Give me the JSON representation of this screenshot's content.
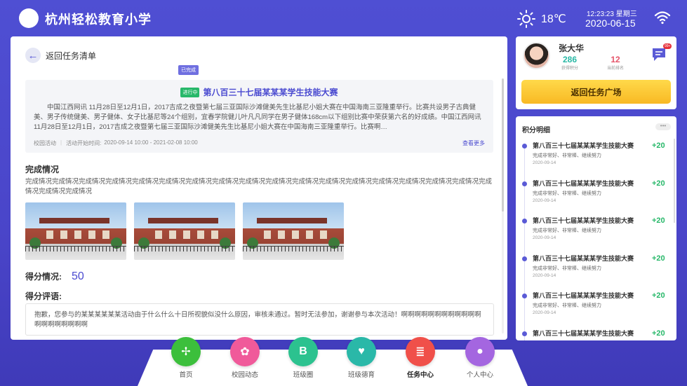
{
  "header": {
    "school": "杭州轻松教育小学",
    "temperature": "18℃",
    "time": "12:23:23 星期三",
    "date": "2020-06-15"
  },
  "task": {
    "back_label": "返回任务清单",
    "done_badge": "已完成",
    "status_badge": "进行中",
    "title": "第八百三十七届某某某学生技能大赛",
    "description": "中国江西网讯 11月28日至12月1日，2017吉成之夜暨第七届三亚国际沙滩健美先生比基尼小姐大赛在中国海南三亚隆重举行。比赛共设男子古典健美、男子传统健美、男子健体、女子比基尼等24个组别，宜春学院健儿叶凡凡同学在男子健体168cm以下组别比赛中荣获第六名的好成绩。中国江西网讯 11月28日至12月1日，2017吉成之夜暨第七届三亚国际沙滩健美先生比基尼小姐大赛在中国海南三亚隆重举行。比赛啊…",
    "category": "校园活动",
    "time_label": "活动开始时间:",
    "time_range": "2020-09-14 10:00 - 2021-02-08 10:00",
    "more_label": "查看更多",
    "complete_title": "完成情况",
    "complete_text": "完成情况完成情况完成情况完成情况完成情况完成情况完成情况完成情况完成情况完成情况完成情况完成情况完成情况完成情况完成情况完成情况完成情况完成情况完成情况完成情况",
    "score_label": "得分情况:",
    "score_value": "50",
    "comment_title": "得分评语:",
    "comment_text": "抱歉，您参与的某某某某某某活动由于什么什么十日所视貌似没什么原因，审核未通过。暂时无法参加，谢谢参与本次活动！啊啊啊啊啊啊啊啊啊啊啊啊啊啊啊啊啊啊啊啊"
  },
  "profile": {
    "name": "张大华",
    "points_value": "286",
    "points_label": "获得积分",
    "rank_value": "12",
    "rank_label": "当前排名",
    "msg_badge": "99+",
    "return_button": "返回任务广场"
  },
  "points": {
    "title": "积分明细",
    "more_label": "•••",
    "items": [
      {
        "title": "第八百三十七届某某某学生技能大赛",
        "sub": "完成非常好、非常棒、继续努力",
        "date": "2020-09-14",
        "score": "+20"
      },
      {
        "title": "第八百三十七届某某某学生技能大赛",
        "sub": "完成非常好、非常棒、继续努力",
        "date": "2020-09-14",
        "score": "+20"
      },
      {
        "title": "第八百三十七届某某某学生技能大赛",
        "sub": "完成非常好、非常棒、继续努力",
        "date": "2020-09-14",
        "score": "+20"
      },
      {
        "title": "第八百三十七届某某某学生技能大赛",
        "sub": "完成非常好、非常棒、继续努力",
        "date": "2020-09-14",
        "score": "+20"
      },
      {
        "title": "第八百三十七届某某某学生技能大赛",
        "sub": "完成非常好、非常棒、继续努力",
        "date": "2020-09-14",
        "score": "+20"
      },
      {
        "title": "第八百三十七届某某某学生技能大赛",
        "sub": "完成非常好、非常棒、继续努力",
        "date": "2020-09-14",
        "score": "+20"
      }
    ]
  },
  "nav": {
    "items": [
      {
        "label": "首页",
        "icon": "pinwheel-icon",
        "color": "#3cbf3c"
      },
      {
        "label": "校园动态",
        "icon": "flower-icon",
        "color": "#f05a9a"
      },
      {
        "label": "班级圈",
        "icon": "letter-b-icon",
        "color": "#2cc28f"
      },
      {
        "label": "班级德育",
        "icon": "heart-book-icon",
        "color": "#2ab8a8"
      },
      {
        "label": "任务中心",
        "icon": "task-scroll-icon",
        "color": "#f0504a"
      },
      {
        "label": "个人中心",
        "icon": "person-icon",
        "color": "#a466e0"
      }
    ],
    "active_index": 4
  }
}
